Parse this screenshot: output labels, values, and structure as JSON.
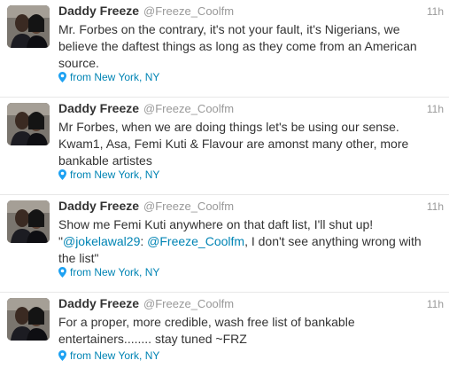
{
  "tweets": [
    {
      "fullname": "Daddy Freeze",
      "username": "@Freeze_Coolfm",
      "time": "11h",
      "text": "Mr. Forbes on the contrary, it's not your fault, it's Nigerians, we believe the daftest things as long as they come from an American source.",
      "location": "from New York, NY"
    },
    {
      "fullname": "Daddy Freeze",
      "username": "@Freeze_Coolfm",
      "time": "11h",
      "text": "Mr Forbes, when we are doing things let's be using our sense. Kwam1, Asa, Femi Kuti & Flavour are amonst many other, more bankable artistes",
      "location": "from New York, NY"
    },
    {
      "fullname": "Daddy Freeze",
      "username": "@Freeze_Coolfm",
      "time": "11h",
      "text_before": "Show me Femi Kuti anywhere on that daft list, I'll shut up! \"",
      "mention1": "@jokelawal29",
      "text_middle": ": ",
      "mention2": "@Freeze_Coolfm",
      "text_after": ", I don't see anything wrong with the list\"",
      "location": "from New York, NY"
    },
    {
      "fullname": "Daddy Freeze",
      "username": "@Freeze_Coolfm",
      "time": "11h",
      "text": "For a proper, more credible, wash free list of bankable entertainers........ stay tuned ~FRZ",
      "location": "from New York, NY"
    }
  ],
  "colors": {
    "link": "#0084b4",
    "muted": "#999999",
    "text": "#333333"
  },
  "icons": {
    "location": "map-pin-icon",
    "avatar": "profile-photo"
  }
}
